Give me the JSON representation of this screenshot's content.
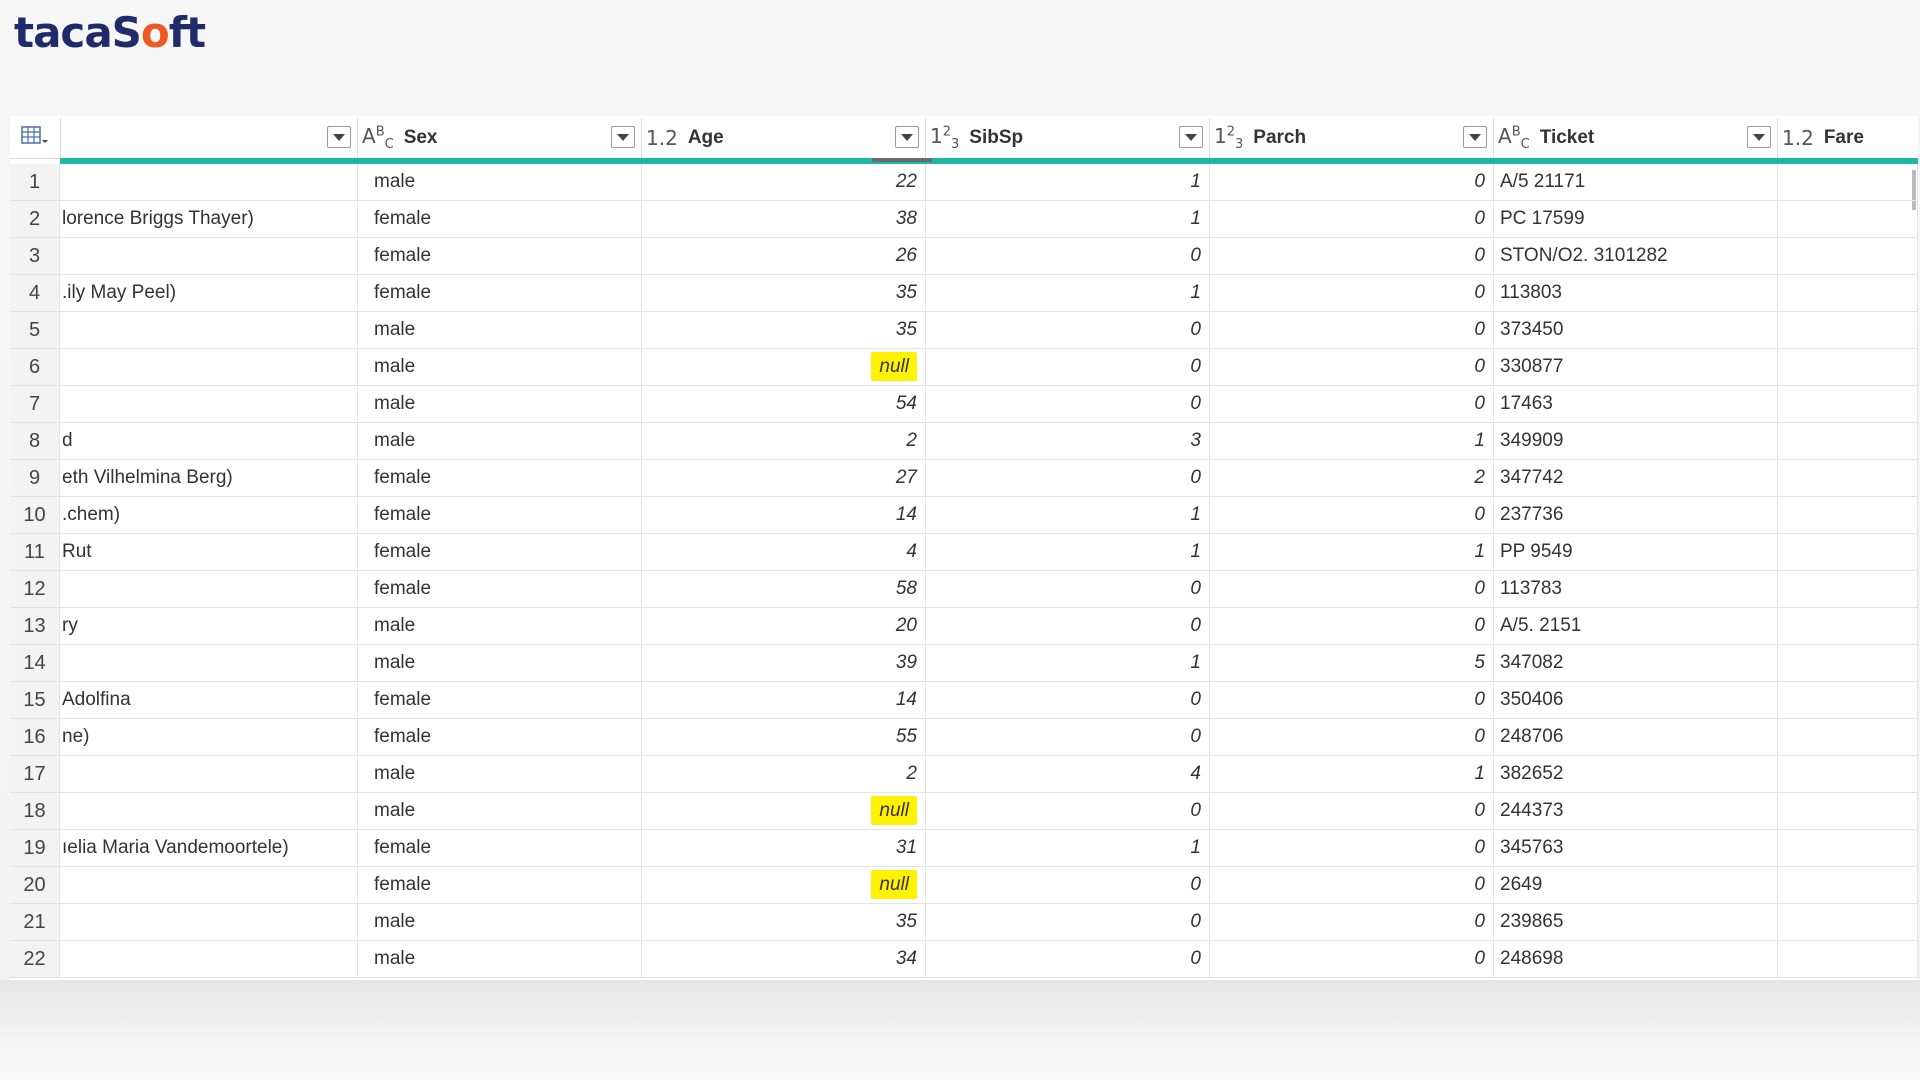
{
  "logo": {
    "text_part1": "tacaS",
    "text_accent": "o",
    "text_part2": "ft"
  },
  "columns": [
    {
      "name": "",
      "type_icon": ""
    },
    {
      "name": "Sex",
      "type_icon": "ABC"
    },
    {
      "name": "Age",
      "type_icon": "1.2"
    },
    {
      "name": "SibSp",
      "type_icon": "123"
    },
    {
      "name": "Parch",
      "type_icon": "123"
    },
    {
      "name": "Ticket",
      "type_icon": "ABC"
    },
    {
      "name": "Fare",
      "type_icon": "1.2"
    }
  ],
  "rows": [
    {
      "n": "1",
      "name": "",
      "sex": "male",
      "age": "22",
      "sibsp": "1",
      "parch": "0",
      "ticket": "A/5 21171"
    },
    {
      "n": "2",
      "name": "lorence Briggs Thayer)",
      "sex": "female",
      "age": "38",
      "sibsp": "1",
      "parch": "0",
      "ticket": "PC 17599"
    },
    {
      "n": "3",
      "name": "",
      "sex": "female",
      "age": "26",
      "sibsp": "0",
      "parch": "0",
      "ticket": "STON/O2. 3101282"
    },
    {
      "n": "4",
      "name": ".ily May Peel)",
      "sex": "female",
      "age": "35",
      "sibsp": "1",
      "parch": "0",
      "ticket": "113803"
    },
    {
      "n": "5",
      "name": "",
      "sex": "male",
      "age": "35",
      "sibsp": "0",
      "parch": "0",
      "ticket": "373450"
    },
    {
      "n": "6",
      "name": "",
      "sex": "male",
      "age": "null",
      "sibsp": "0",
      "parch": "0",
      "ticket": "330877"
    },
    {
      "n": "7",
      "name": "",
      "sex": "male",
      "age": "54",
      "sibsp": "0",
      "parch": "0",
      "ticket": "17463"
    },
    {
      "n": "8",
      "name": "d",
      "sex": "male",
      "age": "2",
      "sibsp": "3",
      "parch": "1",
      "ticket": "349909"
    },
    {
      "n": "9",
      "name": "eth Vilhelmina Berg)",
      "sex": "female",
      "age": "27",
      "sibsp": "0",
      "parch": "2",
      "ticket": "347742"
    },
    {
      "n": "10",
      "name": ".chem)",
      "sex": "female",
      "age": "14",
      "sibsp": "1",
      "parch": "0",
      "ticket": "237736"
    },
    {
      "n": "11",
      "name": "Rut",
      "sex": "female",
      "age": "4",
      "sibsp": "1",
      "parch": "1",
      "ticket": "PP 9549"
    },
    {
      "n": "12",
      "name": "",
      "sex": "female",
      "age": "58",
      "sibsp": "0",
      "parch": "0",
      "ticket": "113783"
    },
    {
      "n": "13",
      "name": "ry",
      "sex": "male",
      "age": "20",
      "sibsp": "0",
      "parch": "0",
      "ticket": "A/5. 2151"
    },
    {
      "n": "14",
      "name": "",
      "sex": "male",
      "age": "39",
      "sibsp": "1",
      "parch": "5",
      "ticket": "347082"
    },
    {
      "n": "15",
      "name": " Adolfina",
      "sex": "female",
      "age": "14",
      "sibsp": "0",
      "parch": "0",
      "ticket": "350406"
    },
    {
      "n": "16",
      "name": "ne)",
      "sex": "female",
      "age": "55",
      "sibsp": "0",
      "parch": "0",
      "ticket": "248706"
    },
    {
      "n": "17",
      "name": "",
      "sex": "male",
      "age": "2",
      "sibsp": "4",
      "parch": "1",
      "ticket": "382652"
    },
    {
      "n": "18",
      "name": "",
      "sex": "male",
      "age": "null",
      "sibsp": "0",
      "parch": "0",
      "ticket": "244373"
    },
    {
      "n": "19",
      "name": "ıelia Maria Vandemoortele)",
      "sex": "female",
      "age": "31",
      "sibsp": "1",
      "parch": "0",
      "ticket": "345763"
    },
    {
      "n": "20",
      "name": "",
      "sex": "female",
      "age": "null",
      "sibsp": "0",
      "parch": "0",
      "ticket": "2649"
    },
    {
      "n": "21",
      "name": "",
      "sex": "male",
      "age": "35",
      "sibsp": "0",
      "parch": "0",
      "ticket": "239865"
    },
    {
      "n": "22",
      "name": "",
      "sex": "male",
      "age": "34",
      "sibsp": "0",
      "parch": "0",
      "ticket": "248698"
    }
  ],
  "colors": {
    "accent_bar": "#1fb5a7",
    "null_highlight": "#fff200",
    "logo_text": "#1f2b6b",
    "logo_accent": "#ee5a24"
  }
}
